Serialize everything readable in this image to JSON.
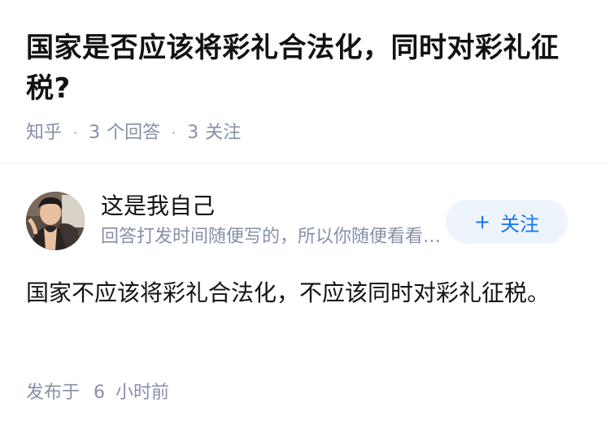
{
  "question": {
    "title": "国家是否应该将彩礼合法化，同时对彩礼征税?",
    "source": "知乎",
    "answer_count": "3",
    "answer_label": "个回答",
    "follower_count": "3",
    "follower_label": "关注",
    "separator": "·"
  },
  "author": {
    "name": "这是我自己",
    "bio": "回答打发时间随便写的，所以你随便看看就好",
    "avatar_icon": "avatar-photo",
    "follow_plus": "+",
    "follow_label": "关注"
  },
  "answer": {
    "content": "国家不应该将彩礼合法化，不应该同时对彩礼征税。",
    "time_prefix": "发布于",
    "time_num": "6",
    "time_unit": "小时前"
  },
  "colors": {
    "text": "#121212",
    "muted": "#8590a6",
    "accent": "#1772f6",
    "follow_bg": "#eef4fb"
  }
}
